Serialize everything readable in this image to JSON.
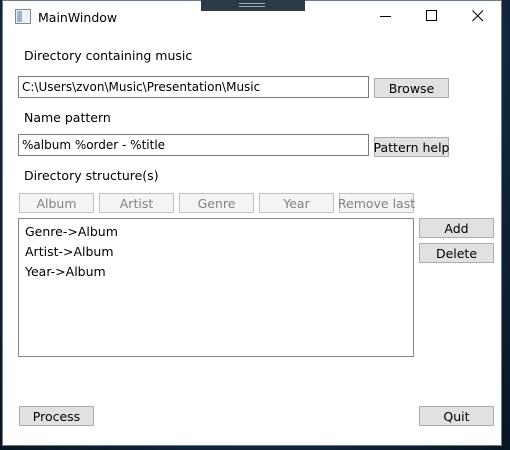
{
  "window": {
    "title": "MainWindow",
    "icons": {
      "app": "window-app-icon",
      "minimize": "minimize-icon",
      "maximize": "maximize-icon",
      "close": "close-icon"
    }
  },
  "music_dir": {
    "label": "Directory containing music",
    "value": "C:\\Users\\zvon\\Music\\Presentation\\Music",
    "browse_label": "Browse"
  },
  "pattern": {
    "label": "Name pattern",
    "value": "%album %order - %title",
    "help_label": "Pattern help"
  },
  "structure": {
    "label": "Directory structure(s)",
    "buttons": [
      "Album",
      "Artist",
      "Genre",
      "Year",
      "Remove last"
    ],
    "items": [
      "Genre->Album",
      "Artist->Album",
      "Year->Album"
    ],
    "add_label": "Add",
    "delete_label": "Delete"
  },
  "footer": {
    "process_label": "Process",
    "quit_label": "Quit"
  }
}
